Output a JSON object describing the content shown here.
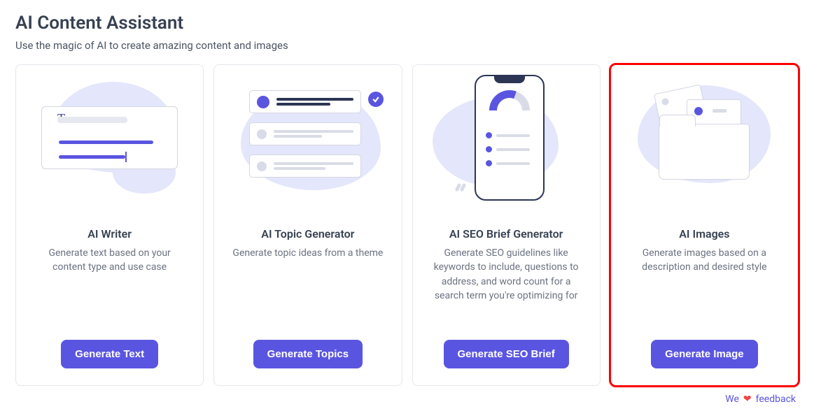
{
  "page": {
    "title": "AI Content Assistant",
    "subtitle": "Use the magic of AI to create amazing content and images"
  },
  "cards": [
    {
      "title": "AI Writer",
      "description": "Generate text based on your content type and use case",
      "button": "Generate Text"
    },
    {
      "title": "AI Topic Generator",
      "description": "Generate topic ideas from a theme",
      "button": "Generate Topics"
    },
    {
      "title": "AI SEO Brief Generator",
      "description": "Generate SEO guidelines like keywords to include, questions to address, and word count for a search term you're optimizing for",
      "button": "Generate SEO Brief"
    },
    {
      "title": "AI Images",
      "description": "Generate images based on a description and desired style",
      "button": "Generate Image"
    }
  ],
  "feedback": {
    "prefix": "We",
    "suffix": "feedback"
  }
}
